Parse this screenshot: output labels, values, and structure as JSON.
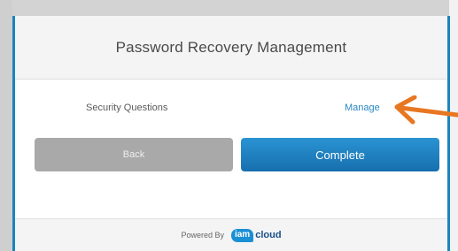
{
  "dialog": {
    "title": "Password Recovery Management",
    "row": {
      "label": "Security Questions",
      "action": "Manage"
    },
    "buttons": {
      "back_label": "Back",
      "complete_label": "Complete"
    },
    "footer": {
      "powered_by": "Powered By",
      "logo_part1": "iam",
      "logo_part2": "cloud"
    }
  },
  "colors": {
    "accent": "#1b84bf",
    "link": "#2a88c4",
    "back_button": "#a9a9a9",
    "complete_button": "#1f82c4",
    "annotation_arrow": "#e87722"
  },
  "annotation": {
    "icon": "arrow-left-icon"
  }
}
